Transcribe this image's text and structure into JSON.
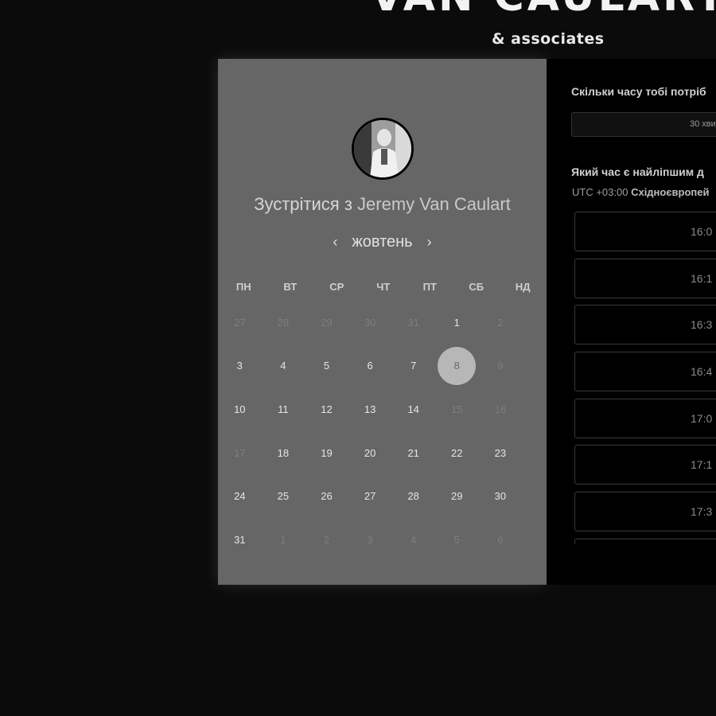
{
  "brand": {
    "title": "VAN CAULART",
    "subtitle": "& associates"
  },
  "calendar": {
    "title_prefix": "Зустрітися з",
    "host_name": "Jeremy Van Caulart",
    "month": "жовтень",
    "prev": "‹",
    "next": "›",
    "weekdays": [
      "ПН",
      "ВТ",
      "СР",
      "ЧТ",
      "ПТ",
      "СБ",
      "НД"
    ],
    "weeks": [
      [
        {
          "d": "27",
          "m": true
        },
        {
          "d": "28",
          "m": true
        },
        {
          "d": "29",
          "m": true
        },
        {
          "d": "30",
          "m": true
        },
        {
          "d": "31",
          "m": true
        },
        {
          "d": "1",
          "m": false
        },
        {
          "d": "2",
          "m": true
        }
      ],
      [
        {
          "d": "3",
          "m": false
        },
        {
          "d": "4",
          "m": false
        },
        {
          "d": "5",
          "m": false
        },
        {
          "d": "6",
          "m": false
        },
        {
          "d": "7",
          "m": false
        },
        {
          "d": "8",
          "m": false,
          "sel": true
        },
        {
          "d": "9",
          "m": true
        }
      ],
      [
        {
          "d": "10",
          "m": false
        },
        {
          "d": "11",
          "m": false
        },
        {
          "d": "12",
          "m": false
        },
        {
          "d": "13",
          "m": false
        },
        {
          "d": "14",
          "m": false
        },
        {
          "d": "15",
          "m": true
        },
        {
          "d": "16",
          "m": true
        }
      ],
      [
        {
          "d": "17",
          "m": true
        },
        {
          "d": "18",
          "m": false
        },
        {
          "d": "19",
          "m": false
        },
        {
          "d": "20",
          "m": false
        },
        {
          "d": "21",
          "m": false
        },
        {
          "d": "22",
          "m": false
        },
        {
          "d": "23",
          "m": false
        }
      ],
      [
        {
          "d": "24",
          "m": false
        },
        {
          "d": "25",
          "m": false
        },
        {
          "d": "26",
          "m": false
        },
        {
          "d": "27",
          "m": false
        },
        {
          "d": "28",
          "m": false
        },
        {
          "d": "29",
          "m": false
        },
        {
          "d": "30",
          "m": false
        }
      ],
      [
        {
          "d": "31",
          "m": false
        },
        {
          "d": "1",
          "m": true
        },
        {
          "d": "2",
          "m": true
        },
        {
          "d": "3",
          "m": true
        },
        {
          "d": "4",
          "m": true
        },
        {
          "d": "5",
          "m": true
        },
        {
          "d": "6",
          "m": true
        }
      ]
    ]
  },
  "booking": {
    "duration_question": "Скільки часу тобі потріб",
    "duration_value": "30 хви",
    "time_question": "Який час є найліпшим д",
    "tz_offset": "UTC +03:00",
    "tz_name": "Східноєвропей",
    "slots": [
      "16:0",
      "16:1",
      "16:3",
      "16:4",
      "17:0",
      "17:1",
      "17:3",
      ""
    ]
  }
}
